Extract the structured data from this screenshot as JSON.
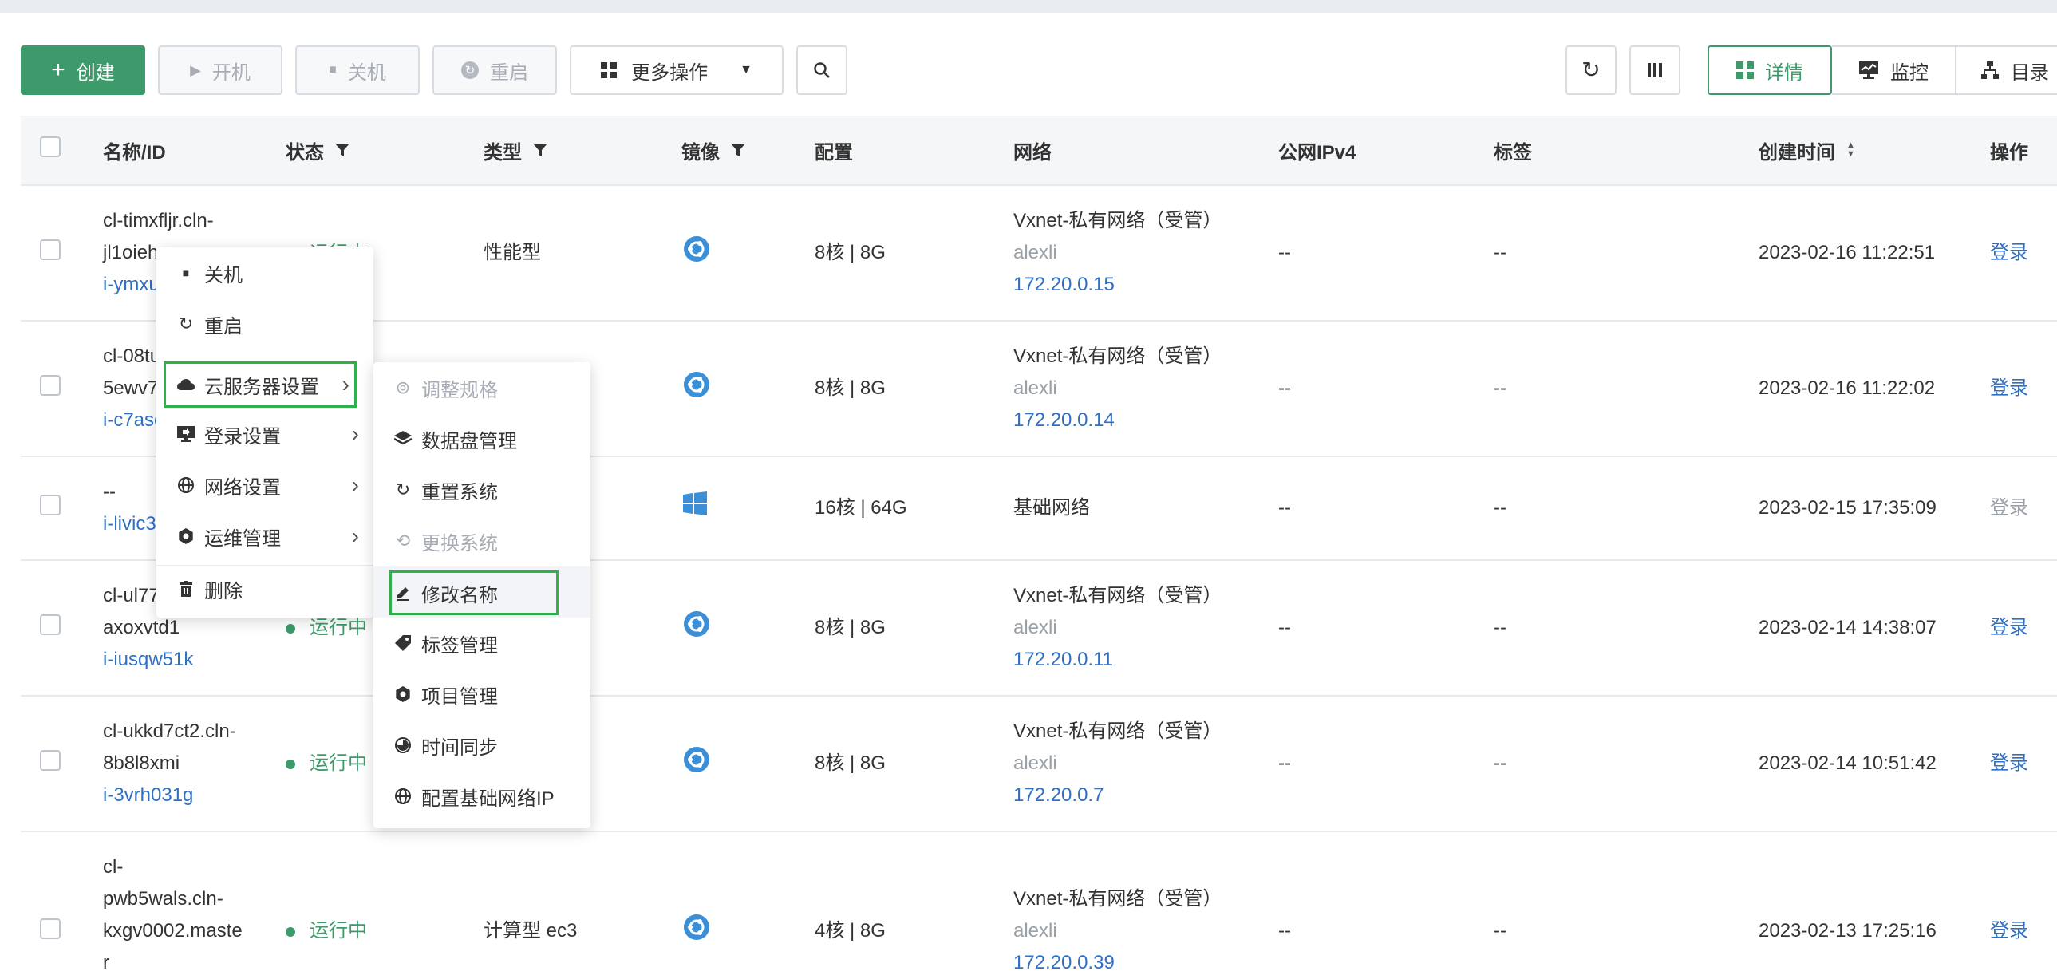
{
  "toolbar": {
    "create": "创建",
    "power_on": "开机",
    "shutdown": "关机",
    "restart": "重启",
    "more_actions": "更多操作",
    "view_detail": "详情",
    "view_monitor": "监控",
    "view_catalog": "目录"
  },
  "columns": {
    "name_id": "名称/ID",
    "status": "状态",
    "type": "类型",
    "image": "镜像",
    "config": "配置",
    "network": "网络",
    "public_ip": "公网IPv4",
    "tags": "标签",
    "created": "创建时间",
    "ops": "操作"
  },
  "rows": [
    {
      "name": [
        "cl-timxfljr.cln-",
        "jl1oieh"
      ],
      "id": "i-ymxu",
      "status": "运行中",
      "type": "性能型",
      "config": "8核 | 8G",
      "net_name": "Vxnet-私有网络（受管）",
      "net_user": "alexli",
      "net_ip": "172.20.0.15",
      "public_ip": "--",
      "tags": "--",
      "created": "2023-02-16 11:22:51",
      "op": "登录"
    },
    {
      "name": [
        "cl-08tu",
        "5ewv7"
      ],
      "id": "i-c7asc",
      "status": "",
      "type": "",
      "config": "8核 | 8G",
      "net_name": "Vxnet-私有网络（受管）",
      "net_user": "alexli",
      "net_ip": "172.20.0.14",
      "public_ip": "--",
      "tags": "--",
      "created": "2023-02-16 11:22:02",
      "op": "登录"
    },
    {
      "name": [
        "--"
      ],
      "id": "i-livic3",
      "status": "",
      "type": "",
      "config": "16核 | 64G",
      "net_name": "基础网络",
      "net_user": "",
      "net_ip": "",
      "public_ip": "--",
      "tags": "--",
      "created": "2023-02-15 17:35:09",
      "op": "登录"
    },
    {
      "name": [
        "cl-ul77",
        "axoxvtd1"
      ],
      "id": "i-iusqw51k",
      "status": "运行中",
      "type": "",
      "config": "8核 | 8G",
      "net_name": "Vxnet-私有网络（受管）",
      "net_user": "alexli",
      "net_ip": "172.20.0.11",
      "public_ip": "--",
      "tags": "--",
      "created": "2023-02-14 14:38:07",
      "op": "登录"
    },
    {
      "name": [
        "cl-ukkd7ct2.cln-",
        "8b8l8xmi"
      ],
      "id": "i-3vrh031g",
      "status": "运行中",
      "type": "",
      "config": "8核 | 8G",
      "net_name": "Vxnet-私有网络（受管）",
      "net_user": "alexli",
      "net_ip": "172.20.0.7",
      "public_ip": "--",
      "tags": "--",
      "created": "2023-02-14 10:51:42",
      "op": "登录"
    },
    {
      "name": [
        "cl-",
        "pwb5wals.cln-",
        "kxgv0002.maste",
        "r"
      ],
      "id": "",
      "status": "运行中",
      "type": "计算型 ec3",
      "config": "4核 | 8G",
      "net_name": "Vxnet-私有网络（受管）",
      "net_user": "alexli",
      "net_ip": "172.20.0.39",
      "public_ip": "--",
      "tags": "--",
      "created": "2023-02-13 17:25:16",
      "op": "登录"
    }
  ],
  "context_menu": {
    "shutdown": "关机",
    "restart": "重启",
    "cloud_settings": "云服务器设置",
    "login_settings": "登录设置",
    "network_settings": "网络设置",
    "ops_management": "运维管理",
    "delete": "删除"
  },
  "submenu": {
    "resize": "调整规格",
    "disk_mgmt": "数据盘管理",
    "reset_system": "重置系统",
    "change_system": "更换系统",
    "rename": "修改名称",
    "tag_mgmt": "标签管理",
    "project_mgmt": "项目管理",
    "time_sync": "时间同步",
    "config_base_ip": "配置基础网络IP"
  },
  "colors": {
    "primary": "#3d9a6a",
    "link": "#2f6fc4",
    "highlight": "#2fb04a",
    "ubuntu": "#3b8fd6",
    "windows": "#3b8fd6"
  }
}
